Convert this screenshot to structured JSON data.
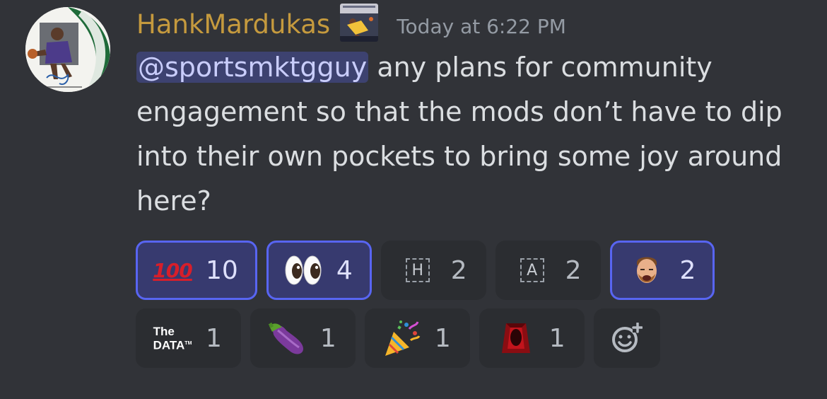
{
  "message": {
    "username": "HankMardukas",
    "timestamp": "Today at 6:22 PM",
    "mention": "@sportsmktgguy",
    "body": " any plans for community engagement so that the mods don’t have to dip into their own pockets to bring some joy around here?"
  },
  "colors": {
    "username": "#c59a3e",
    "mention_bg": "#3d4270",
    "reaction_active_border": "#5865f2",
    "background": "#313338"
  },
  "reactions": {
    "row1": [
      {
        "emoji": "hundred-points-emoji",
        "count": "10",
        "active": true
      },
      {
        "emoji": "eyes-emoji",
        "count": "4",
        "active": true
      },
      {
        "emoji": "custom-emoji-h",
        "glyph": "H",
        "count": "2",
        "active": false
      },
      {
        "emoji": "custom-emoji-a",
        "glyph": "A",
        "count": "2",
        "active": false
      },
      {
        "emoji": "mcgregor-face-emoji",
        "count": "2",
        "active": true
      }
    ],
    "row2": [
      {
        "emoji": "the-data-logo-emoji",
        "count": "1",
        "active": false
      },
      {
        "emoji": "eggplant-emoji",
        "count": "1",
        "active": false
      },
      {
        "emoji": "party-popper-emoji",
        "count": "1",
        "active": false
      },
      {
        "emoji": "red-cape-emoji",
        "count": "1",
        "active": false
      }
    ]
  },
  "emoji_text": {
    "hundred": "100",
    "data_line1": "The",
    "data_line2": "DATA",
    "data_tm": "TM"
  },
  "add_reaction_icon": "add-reaction-icon"
}
